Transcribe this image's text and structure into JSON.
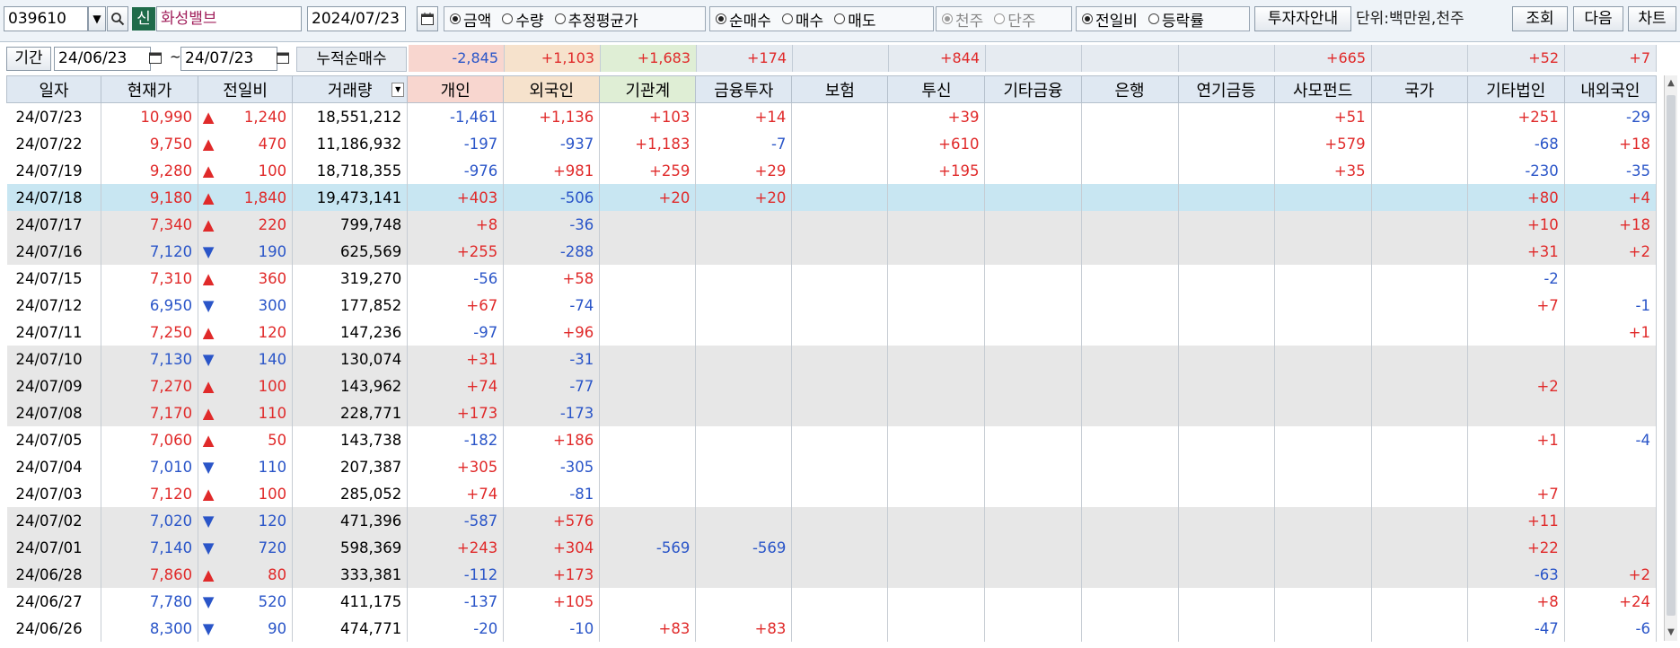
{
  "toolbar": {
    "stock_code": "039610",
    "badge": "신",
    "stock_name": "화성밸브",
    "date": "2024/07/23",
    "mode_group": [
      "금액",
      "수량",
      "추정평균가"
    ],
    "trade_group": [
      "순매수",
      "매수",
      "매도"
    ],
    "unit_group": [
      "천주",
      "단주"
    ],
    "compare_group": [
      "전일비",
      "등락률"
    ],
    "investor_info_button": "투자자안내",
    "unit_label": "단위:백만원,천주",
    "query_button": "조회",
    "next_button": "다음",
    "chart_button": "차트"
  },
  "period": {
    "label": "기간",
    "from": "24/06/23",
    "sep": "~",
    "to": "24/07/23",
    "cumulative_label": "누적순매수"
  },
  "summary": [
    "-2,845",
    "+1,103",
    "+1,683",
    "+174",
    "",
    "+844",
    "",
    "",
    "",
    "+665",
    "",
    "+52",
    "+7"
  ],
  "columns": [
    "일자",
    "현재가",
    "전일비",
    "거래량",
    "개인",
    "외국인",
    "기관계",
    "금융투자",
    "보험",
    "투신",
    "기타금융",
    "은행",
    "연기금등",
    "사모펀드",
    "국가",
    "기타법인",
    "내외국인"
  ],
  "rows": [
    {
      "date": "24/07/23",
      "price": "10,990",
      "dir": "up",
      "chg": "1,240",
      "vol": "18,551,212",
      "v": [
        "-1,461",
        "+1,136",
        "+103",
        "+14",
        "",
        "+39",
        "",
        "",
        "",
        "+51",
        "",
        "+251",
        "-29"
      ]
    },
    {
      "date": "24/07/22",
      "price": "9,750",
      "dir": "up",
      "chg": "470",
      "vol": "11,186,932",
      "v": [
        "-197",
        "-937",
        "+1,183",
        "-7",
        "",
        "+610",
        "",
        "",
        "",
        "+579",
        "",
        "-68",
        "+18"
      ]
    },
    {
      "date": "24/07/19",
      "price": "9,280",
      "dir": "up",
      "chg": "100",
      "vol": "18,718,355",
      "v": [
        "-976",
        "+981",
        "+259",
        "+29",
        "",
        "+195",
        "",
        "",
        "",
        "+35",
        "",
        "-230",
        "-35"
      ]
    },
    {
      "date": "24/07/18",
      "price": "9,180",
      "dir": "up",
      "chg": "1,840",
      "vol": "19,473,141",
      "v": [
        "+403",
        "-506",
        "+20",
        "+20",
        "",
        "",
        "",
        "",
        "",
        "",
        "",
        "+80",
        "+4"
      ]
    },
    {
      "date": "24/07/17",
      "price": "7,340",
      "dir": "up",
      "chg": "220",
      "vol": "799,748",
      "v": [
        "+8",
        "-36",
        "",
        "",
        "",
        "",
        "",
        "",
        "",
        "",
        "",
        "+10",
        "+18"
      ]
    },
    {
      "date": "24/07/16",
      "price": "7,120",
      "dir": "down",
      "chg": "190",
      "vol": "625,569",
      "v": [
        "+255",
        "-288",
        "",
        "",
        "",
        "",
        "",
        "",
        "",
        "",
        "",
        "+31",
        "+2"
      ]
    },
    {
      "date": "24/07/15",
      "price": "7,310",
      "dir": "up",
      "chg": "360",
      "vol": "319,270",
      "v": [
        "-56",
        "+58",
        "",
        "",
        "",
        "",
        "",
        "",
        "",
        "",
        "",
        "-2",
        ""
      ]
    },
    {
      "date": "24/07/12",
      "price": "6,950",
      "dir": "down",
      "chg": "300",
      "vol": "177,852",
      "v": [
        "+67",
        "-74",
        "",
        "",
        "",
        "",
        "",
        "",
        "",
        "",
        "",
        "+7",
        "-1"
      ]
    },
    {
      "date": "24/07/11",
      "price": "7,250",
      "dir": "up",
      "chg": "120",
      "vol": "147,236",
      "v": [
        "-97",
        "+96",
        "",
        "",
        "",
        "",
        "",
        "",
        "",
        "",
        "",
        "",
        "+1"
      ]
    },
    {
      "date": "24/07/10",
      "price": "7,130",
      "dir": "down",
      "chg": "140",
      "vol": "130,074",
      "v": [
        "+31",
        "-31",
        "",
        "",
        "",
        "",
        "",
        "",
        "",
        "",
        "",
        "",
        ""
      ]
    },
    {
      "date": "24/07/09",
      "price": "7,270",
      "dir": "up",
      "chg": "100",
      "vol": "143,962",
      "v": [
        "+74",
        "-77",
        "",
        "",
        "",
        "",
        "",
        "",
        "",
        "",
        "",
        "+2",
        ""
      ]
    },
    {
      "date": "24/07/08",
      "price": "7,170",
      "dir": "up",
      "chg": "110",
      "vol": "228,771",
      "v": [
        "+173",
        "-173",
        "",
        "",
        "",
        "",
        "",
        "",
        "",
        "",
        "",
        "",
        ""
      ]
    },
    {
      "date": "24/07/05",
      "price": "7,060",
      "dir": "up",
      "chg": "50",
      "vol": "143,738",
      "v": [
        "-182",
        "+186",
        "",
        "",
        "",
        "",
        "",
        "",
        "",
        "",
        "",
        "+1",
        "-4"
      ]
    },
    {
      "date": "24/07/04",
      "price": "7,010",
      "dir": "down",
      "chg": "110",
      "vol": "207,387",
      "v": [
        "+305",
        "-305",
        "",
        "",
        "",
        "",
        "",
        "",
        "",
        "",
        "",
        "",
        ""
      ]
    },
    {
      "date": "24/07/03",
      "price": "7,120",
      "dir": "up",
      "chg": "100",
      "vol": "285,052",
      "v": [
        "+74",
        "-81",
        "",
        "",
        "",
        "",
        "",
        "",
        "",
        "",
        "",
        "+7",
        ""
      ]
    },
    {
      "date": "24/07/02",
      "price": "7,020",
      "dir": "down",
      "chg": "120",
      "vol": "471,396",
      "v": [
        "-587",
        "+576",
        "",
        "",
        "",
        "",
        "",
        "",
        "",
        "",
        "",
        "+11",
        ""
      ]
    },
    {
      "date": "24/07/01",
      "price": "7,140",
      "dir": "down",
      "chg": "720",
      "vol": "598,369",
      "v": [
        "+243",
        "+304",
        "-569",
        "-569",
        "",
        "",
        "",
        "",
        "",
        "",
        "",
        "+22",
        ""
      ]
    },
    {
      "date": "24/06/28",
      "price": "7,860",
      "dir": "up",
      "chg": "80",
      "vol": "333,381",
      "v": [
        "-112",
        "+173",
        "",
        "",
        "",
        "",
        "",
        "",
        "",
        "",
        "",
        "-63",
        "+2"
      ]
    },
    {
      "date": "24/06/27",
      "price": "7,780",
      "dir": "down",
      "chg": "520",
      "vol": "411,175",
      "v": [
        "-137",
        "+105",
        "",
        "",
        "",
        "",
        "",
        "",
        "",
        "",
        "",
        "+8",
        "+24"
      ]
    },
    {
      "date": "24/06/26",
      "price": "8,300",
      "dir": "down",
      "chg": "90",
      "vol": "474,771",
      "v": [
        "-20",
        "-10",
        "+83",
        "+83",
        "",
        "",
        "",
        "",
        "",
        "",
        "",
        "-47",
        "-6"
      ]
    }
  ],
  "colors": {
    "up": "#e02a2a",
    "down": "#2a55c8",
    "header_bg": "#dfe8f2",
    "gray_row": "#e7e7e7",
    "selected_row": "#c8e6f2"
  }
}
